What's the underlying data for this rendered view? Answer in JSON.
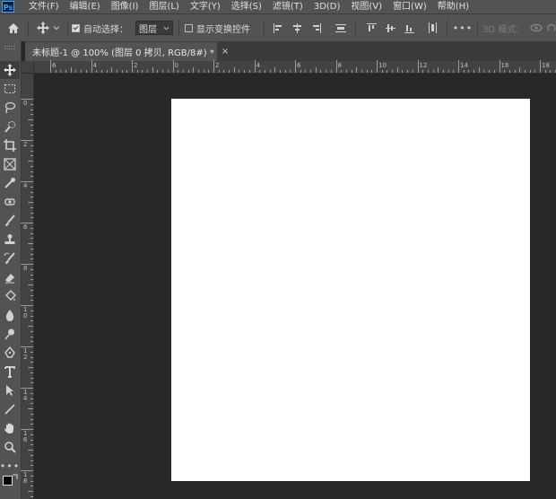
{
  "app": {
    "logo_text": "Ps"
  },
  "menu": [
    {
      "label": "文件(F)"
    },
    {
      "label": "编辑(E)"
    },
    {
      "label": "图像(I)"
    },
    {
      "label": "图层(L)"
    },
    {
      "label": "文字(Y)"
    },
    {
      "label": "选择(S)"
    },
    {
      "label": "滤镜(T)"
    },
    {
      "label": "3D(D)"
    },
    {
      "label": "视图(V)"
    },
    {
      "label": "窗口(W)"
    },
    {
      "label": "帮助(H)"
    }
  ],
  "options_bar": {
    "auto_select": {
      "label": "自动选择：",
      "checked": true
    },
    "auto_select_target": {
      "value": "图层"
    },
    "show_transform": {
      "label": "显示变换控件",
      "checked": false
    },
    "more_label": "•••",
    "mode_3d_label": "3D 模式："
  },
  "document_tab": {
    "title": "未标题-1 @ 100% (图层 0 拷贝, RGB/8#) *",
    "close_glyph": "×"
  },
  "rulers": {
    "horizontal_labels": [
      "6",
      "4",
      "2",
      "0",
      "2",
      "4",
      "6",
      "8",
      "10",
      "12",
      "14",
      "16",
      "18"
    ],
    "vertical_labels": [
      "0",
      "2",
      "4",
      "6",
      "8",
      "1\n0",
      "1\n2",
      "1\n4",
      "1\n6",
      "1\n8"
    ]
  },
  "colors": {
    "canvas": "#ffffff",
    "workspace": "#282828",
    "panel": "#535353",
    "accent": "#31a8ff"
  }
}
